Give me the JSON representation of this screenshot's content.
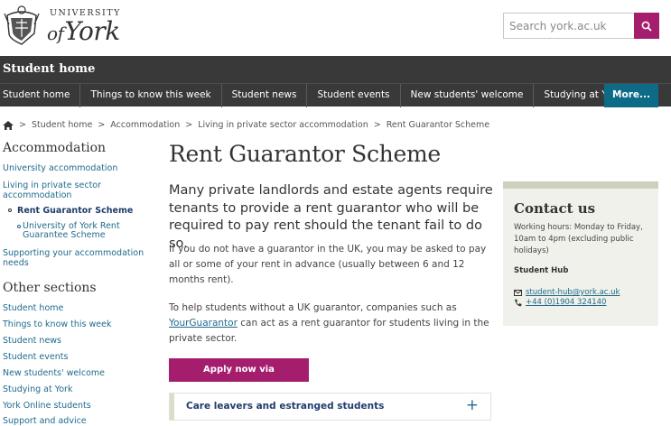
{
  "header": {
    "logo_top": "UNIVERSITY",
    "logo_of": "of",
    "logo_name": "York",
    "search_placeholder": "Search york.ac.uk"
  },
  "site_title": "Student home",
  "nav": {
    "items": [
      "Student home",
      "Things to know this week",
      "Student news",
      "Student events",
      "New students' welcome",
      "Studying at York"
    ],
    "more": "More..."
  },
  "breadcrumb": [
    "Student home",
    "Accommodation",
    "Living in private sector accommodation",
    "Rent Guarantor Scheme"
  ],
  "sidebar": {
    "heading": "Accommodation",
    "link_university": "University accommodation",
    "link_living": "Living in private sector accommodation",
    "current": "Rent Guarantor Scheme",
    "sub": "University of York Rent Guarantee Scheme",
    "link_supporting": "Supporting your accommodation needs",
    "other_heading": "Other sections",
    "other": [
      "Student home",
      "Things to know this week",
      "Student news",
      "Student events",
      "New students' welcome",
      "Studying at York",
      "York Online students",
      "Support and advice"
    ]
  },
  "main": {
    "title": "Rent Guarantor Scheme",
    "lead": "Many private landlords and estate agents require tenants to provide a rent guarantor who will be required to pay rent should the tenant fail to do so.",
    "para1": "If you do not have a guarantor in the UK, you may be asked to pay all or some of your rent in advance (usually between 6 and 12 months rent).",
    "para2_a": "To help students without a UK guarantor, companies such as ",
    "para2_link": "YourGuarantor",
    "para2_b": " can act as a rent guarantor for students living in the private sector.",
    "apply_button": "Apply now via YourGuarantor",
    "accordion_label": "Care leavers and estranged students",
    "accordion_toggle": "+"
  },
  "contact": {
    "heading": "Contact us",
    "hours": "Working hours: Monday to Friday, 10am to 4pm (excluding public holidays)",
    "sub": "Student Hub",
    "email": "student-hub@york.ac.uk",
    "phone": "+44 (0)1904 324140"
  },
  "colors": {
    "accent": "#a51e6e",
    "nav_bg": "#393939",
    "more_bg": "#0d6b88",
    "link": "#1f6b8c"
  }
}
